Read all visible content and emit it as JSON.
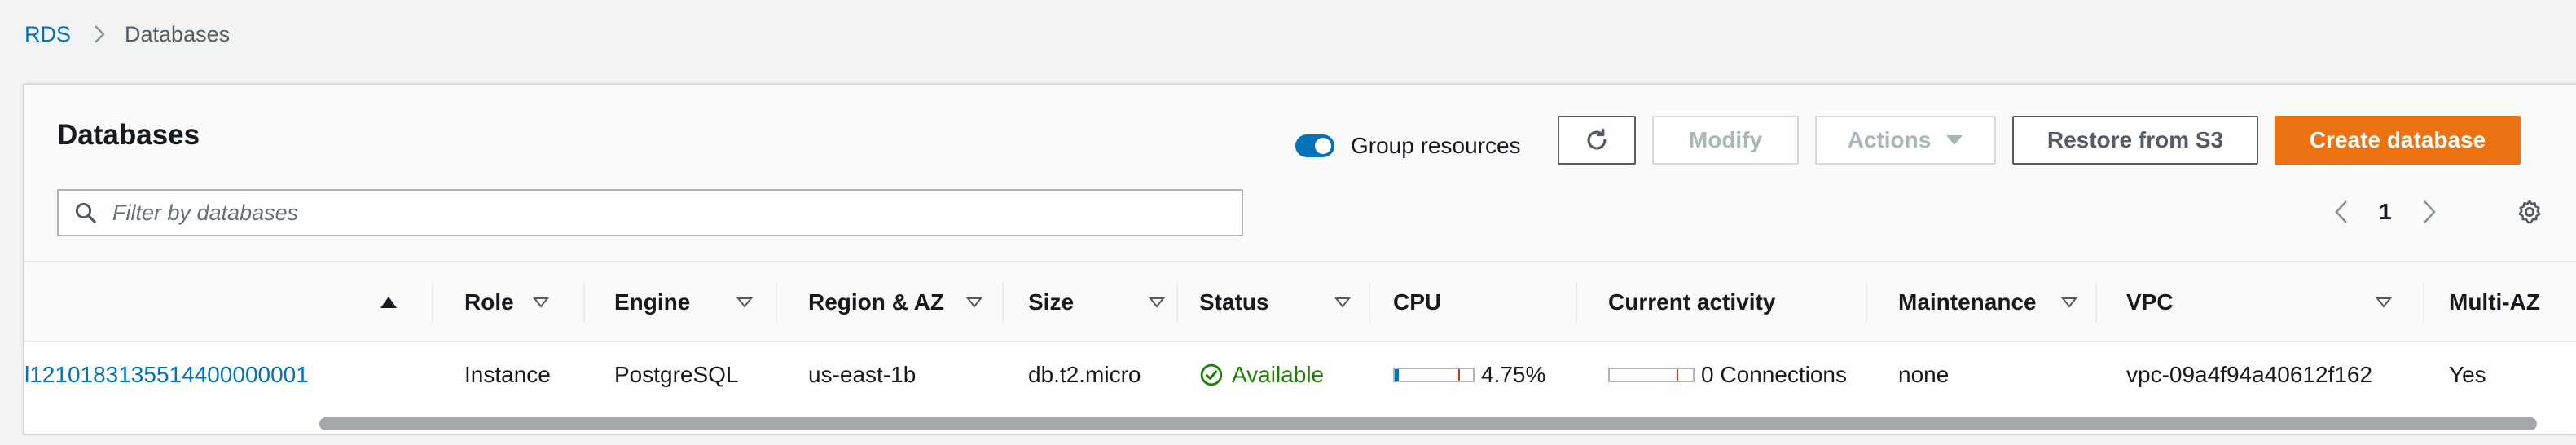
{
  "breadcrumb": {
    "root": "RDS",
    "current": "Databases"
  },
  "panel": {
    "title": "Databases"
  },
  "toolbar": {
    "group_resources_label": "Group resources",
    "group_resources_on": true,
    "refresh_icon": "refresh-icon",
    "modify_label": "Modify",
    "actions_label": "Actions",
    "restore_label": "Restore from S3",
    "create_label": "Create database"
  },
  "filter": {
    "placeholder": "Filter by databases",
    "value": ""
  },
  "pagination": {
    "current_page": "1"
  },
  "columns": [
    {
      "key": "identifier",
      "label": ""
    },
    {
      "key": "role",
      "label": "Role"
    },
    {
      "key": "engine",
      "label": "Engine"
    },
    {
      "key": "region",
      "label": "Region & AZ"
    },
    {
      "key": "size",
      "label": "Size"
    },
    {
      "key": "status",
      "label": "Status"
    },
    {
      "key": "cpu",
      "label": "CPU"
    },
    {
      "key": "activity",
      "label": "Current activity"
    },
    {
      "key": "maintenance",
      "label": "Maintenance"
    },
    {
      "key": "vpc",
      "label": "VPC"
    },
    {
      "key": "multiaz",
      "label": "Multi-AZ"
    }
  ],
  "rows": [
    {
      "identifier": "l1210183135514400000001",
      "role": "Instance",
      "engine": "PostgreSQL",
      "region": "us-east-1b",
      "size": "db.t2.micro",
      "status": "Available",
      "cpu": "4.75%",
      "cpu_fraction": 0.0475,
      "activity": "0 Connections",
      "maintenance": "none",
      "vpc": "vpc-09a4f94a40612f162",
      "multiaz": "Yes"
    }
  ],
  "colors": {
    "link": "#0073bb",
    "primary_button": "#ec7211",
    "status_available": "#1d8102",
    "toggle_on": "#0073bb"
  },
  "icons": {
    "breadcrumb_separator": "chevron-right-icon",
    "sort": "sort-caret-icon",
    "status": "check-circle-icon",
    "settings": "gear-icon",
    "search": "search-icon"
  }
}
